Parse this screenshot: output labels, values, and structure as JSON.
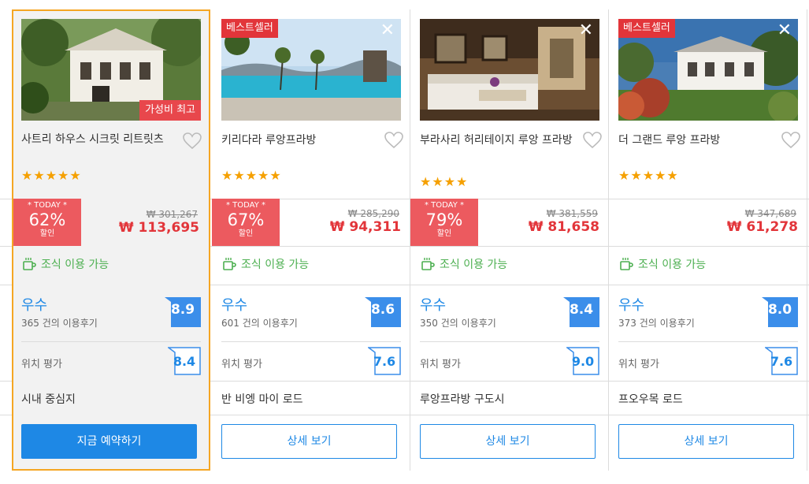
{
  "hotels": [
    {
      "name": "사트리 하우스 시크릿 리트릿츠",
      "badge_top": "",
      "badge_bottom": "가성비 최고",
      "stars": "★★★★★",
      "today_label": "* TODAY *",
      "discount": "62%",
      "discount_unit": "할인",
      "original_price": "₩ 301,267",
      "price": "₩ 113,695",
      "breakfast": "조식 이용 가능",
      "rating_word": "우수",
      "reviews": "365 건의 이용후기",
      "score": "8.9",
      "location_label": "위치 평가",
      "location_score": "8.4",
      "area": "시내 중심지",
      "button": "지금 예약하기"
    },
    {
      "name": "키리다라 루앙프라방",
      "badge_top": "베스트셀러",
      "badge_bottom": "",
      "stars": "★★★★★",
      "today_label": "* TODAY *",
      "discount": "67%",
      "discount_unit": "할인",
      "original_price": "₩ 285,290",
      "price": "₩ 94,311",
      "breakfast": "조식 이용 가능",
      "rating_word": "우수",
      "reviews": "601 건의 이용후기",
      "score": "8.6",
      "location_label": "위치 평가",
      "location_score": "7.6",
      "area": "반 비엥 마이 로드",
      "button": "상세 보기"
    },
    {
      "name": "부라사리 허리테이지 루앙 프라방",
      "badge_top": "",
      "badge_bottom": "",
      "stars": "★★★★",
      "today_label": "* TODAY *",
      "discount": "79%",
      "discount_unit": "할인",
      "original_price": "₩ 381,559",
      "price": "₩ 81,658",
      "breakfast": "조식 이용 가능",
      "rating_word": "우수",
      "reviews": "350 건의 이용후기",
      "score": "8.4",
      "location_label": "위치 평가",
      "location_score": "9.0",
      "area": "루앙프라방 구도시",
      "button": "상세 보기"
    },
    {
      "name": "더 그랜드 루앙 프라방",
      "badge_top": "베스트셀러",
      "badge_bottom": "",
      "stars": "★★★★★",
      "today_label": "",
      "discount": "",
      "discount_unit": "",
      "original_price": "₩ 347,689",
      "price": "₩ 61,278",
      "breakfast": "조식 이용 가능",
      "rating_word": "우수",
      "reviews": "373 건의 이용후기",
      "score": "8.0",
      "location_label": "위치 평가",
      "location_score": "7.6",
      "area": "프오우목 로드",
      "button": "상세 보기"
    }
  ],
  "colors": {
    "accent_blue": "#1e88e5",
    "sale_red": "#e2353a",
    "breakfast_green": "#4caf50",
    "star_orange": "#f5a000",
    "selected_border": "#f5a623"
  }
}
